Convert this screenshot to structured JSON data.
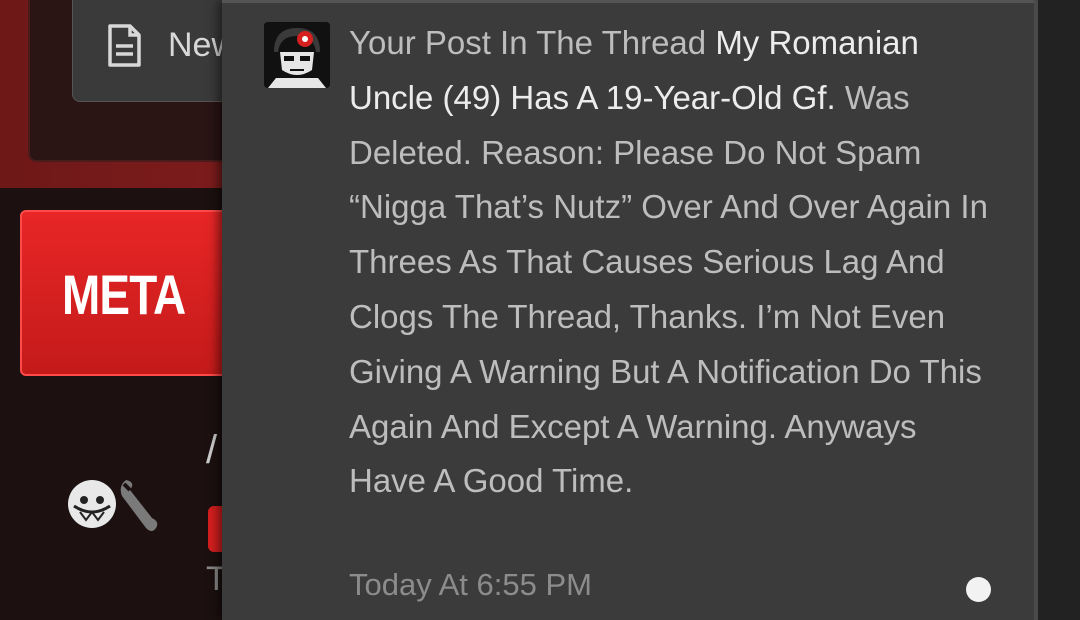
{
  "background": {
    "new_button_label": "New",
    "meta_label": "META",
    "slash_text": "/",
    "truncated_text": "T"
  },
  "notification": {
    "text_before": "Your Post In The Thread ",
    "thread_title": "My Romanian Uncle (49) Has A 19-Year-Old Gf.",
    "text_after": " Was Deleted. Reason: Please Do Not Spam “Nigga That’s Nutz” Over And Over Again In Threes As That Causes Serious Lag And Clogs The Thread, Thanks. I’m Not Even Giving A Warning But A Notification Do This Again And Except A Warning. Anyways Have A Good Time.",
    "timestamp": "Today At 6:55 PM",
    "unread": true
  },
  "icons": {
    "new_button": "document-icon",
    "notification_avatar": "user-avatar",
    "tile_avatar": "user-avatar",
    "tool": "wrench-icon"
  },
  "colors": {
    "accent": "#e02424",
    "popup_bg": "#3b3b3b",
    "link_text": "#ececec",
    "body_text": "#bdbdbd"
  }
}
